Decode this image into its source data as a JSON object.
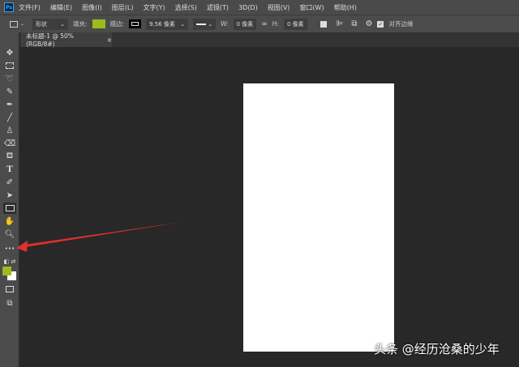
{
  "app_logo": "Ps",
  "menu": [
    "文件(F)",
    "编辑(E)",
    "图像(I)",
    "图层(L)",
    "文字(Y)",
    "选择(S)",
    "滤镜(T)",
    "3D(D)",
    "视图(V)",
    "窗口(W)",
    "帮助(H)"
  ],
  "options": {
    "mode": "形状",
    "fill_label": "填充:",
    "fill_color": "#9bbb1e",
    "stroke_label": "描边:",
    "stroke_width": "9.56 像素",
    "w_label": "W:",
    "w_value": "0 像素",
    "h_label": "H:",
    "h_value": "0 像素",
    "align_edges": "对齐边缘"
  },
  "document_tab": {
    "title": "未标题-1 @ 50%(RGB/8#)",
    "close": "×"
  },
  "toolbar": {
    "more": "•••"
  },
  "watermark": "头条 @经历沧桑的少年"
}
